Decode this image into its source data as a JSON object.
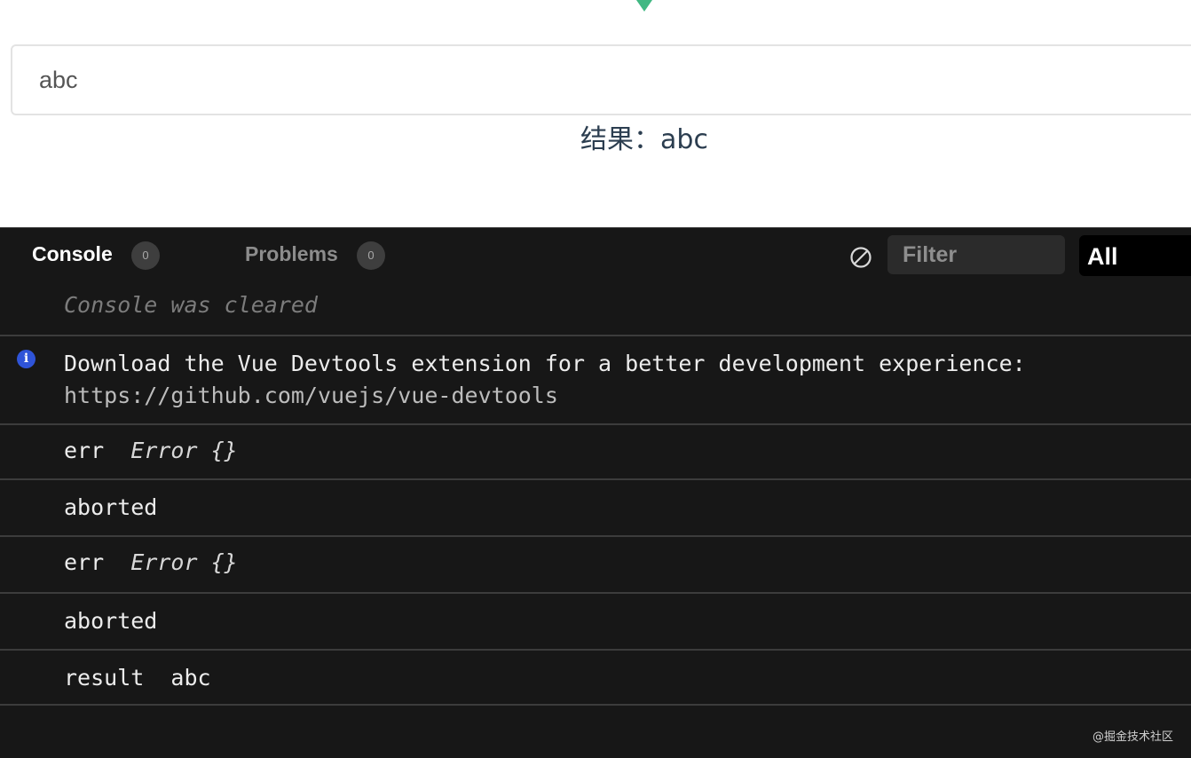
{
  "app": {
    "input_value": "abc",
    "result_text": "结果：abc"
  },
  "console": {
    "tabs": [
      {
        "label": "Console",
        "count": "0"
      },
      {
        "label": "Problems",
        "count": "0"
      }
    ],
    "filter_placeholder": "Filter",
    "level_select": "All",
    "cleared_message": "Console was cleared",
    "messages": [
      {
        "kind": "info",
        "text": "Download the Vue Devtools extension for a better development experience:",
        "link": "https://github.com/vuejs/vue-devtools"
      },
      {
        "kind": "log",
        "label": "err",
        "value": "Error {}"
      },
      {
        "kind": "log",
        "text": "aborted"
      },
      {
        "kind": "log",
        "label": "err",
        "value": "Error {}"
      },
      {
        "kind": "log",
        "text": "aborted"
      },
      {
        "kind": "log",
        "label": "result",
        "value": "abc"
      }
    ]
  },
  "icons": {
    "info": "info-icon",
    "clear": "clear-console-icon"
  },
  "colors": {
    "vue_green": "#41b883",
    "info_blue": "#2f54d8",
    "panel_bg": "#171717"
  },
  "watermark": "@掘金技术社区"
}
